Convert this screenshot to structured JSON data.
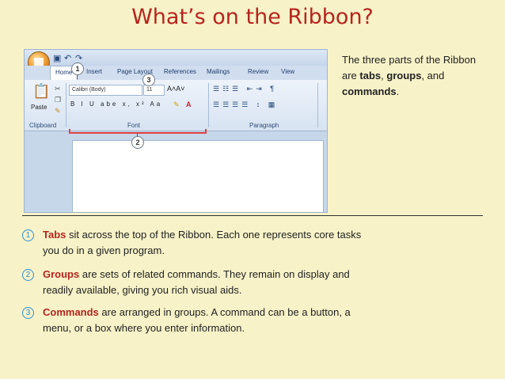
{
  "title": "What’s on the Ribbon?",
  "intro": {
    "prefix": "The three parts of the Ribbon are ",
    "tabs": "tabs",
    "comma1": ", ",
    "groups": "groups",
    "comma2": ", and ",
    "commands": "commands",
    "suffix": "."
  },
  "screenshot": {
    "tabs": [
      "Home",
      "Insert",
      "Page Layout",
      "References",
      "Mailings",
      "Review",
      "View"
    ],
    "font_name": "Calibri (Body)",
    "font_size": "11",
    "groups": [
      "Clipboard",
      "Font",
      "Paragraph"
    ],
    "paste_label": "Paste",
    "format_buttons": "B I U abe x, x² Aa",
    "callouts": [
      "1",
      "2",
      "3"
    ]
  },
  "items": [
    {
      "num": "1",
      "keyword": "Tabs",
      "text": " sit across the top of the Ribbon. Each one represents core tasks you do in a given program."
    },
    {
      "num": "2",
      "keyword": "Groups",
      "text": " are sets of related commands. They remain on display and readily available, giving you rich visual aids."
    },
    {
      "num": "3",
      "keyword": "Commands",
      "text": " are arranged in groups. A command can be a button, a menu, or a box where you enter information."
    }
  ],
  "colors": {
    "background": "#f8f2c8",
    "accent": "#b5251f",
    "number": "#2b8fd8"
  }
}
